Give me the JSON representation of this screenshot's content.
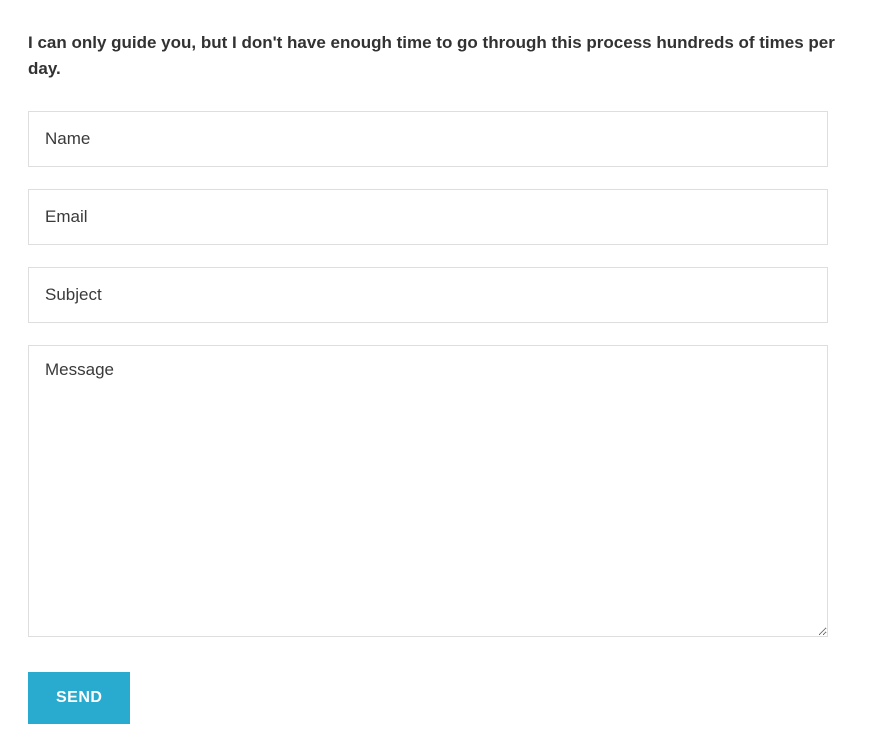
{
  "intro": "I can only guide you, but I don't have enough time to go through this process hundreds of times per day.",
  "form": {
    "name_placeholder": "Name",
    "email_placeholder": "Email",
    "subject_placeholder": "Subject",
    "message_placeholder": "Message",
    "send_label": "SEND"
  }
}
